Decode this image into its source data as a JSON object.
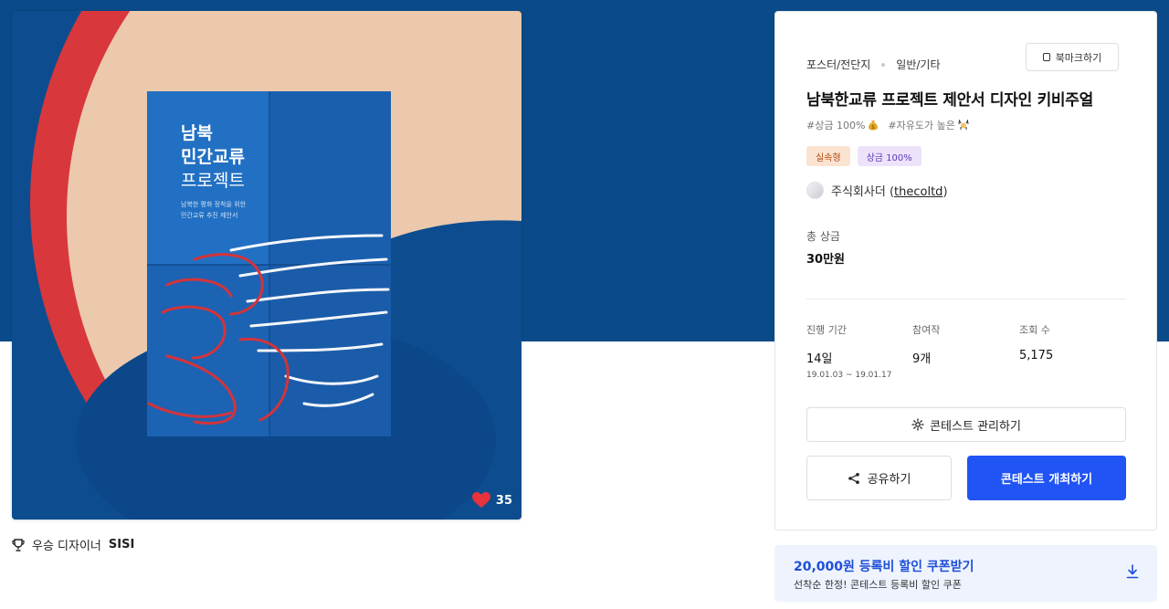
{
  "colors": {
    "hero_background": "#0a4a88",
    "primary_button": "#2154f4",
    "coupon_background": "#eef3fe",
    "coupon_title": "#1d4fd8",
    "heart": "#e8323c"
  },
  "artwork": {
    "poster_title_line1": "남북",
    "poster_title_line2": "민간교류",
    "poster_title_line3": "프로젝트",
    "poster_subtitle_line1": "남북한 평화 정착을 위한",
    "poster_subtitle_line2": "민간교류 추진 제안서",
    "likes": "35",
    "like_icon": "heart-icon"
  },
  "winner": {
    "icon": "trophy-icon",
    "label": "우승 디자이너",
    "name": "SISI"
  },
  "contest": {
    "category": "포스터/전단지",
    "subcategory": "일반/기타",
    "bookmark_label": "북마크하기",
    "title": "남북한교류 프로젝트 제안서 디자인 키비주얼",
    "tags": [
      "#상금 100%",
      "#자유도가 높은"
    ],
    "badges": [
      "실속형",
      "상금 100%"
    ],
    "host_name": "주식회사더",
    "host_handle": "thecoltd",
    "prize_label": "총 상금",
    "prize_amount": "30만원",
    "stats": {
      "period_label": "진행 기간",
      "period_value": "14일",
      "period_dates": "19.01.03 ~ 19.01.17",
      "entries_label": "참여작",
      "entries_value": "9개",
      "views_label": "조회 수",
      "views_value": "5,175"
    },
    "manage_button": "콘테스트 관리하기",
    "share_button": "공유하기",
    "host_button": "콘테스트 개최하기"
  },
  "coupon": {
    "title": "20,000원 등록비 할인 쿠폰받기",
    "subtitle": "선착순 한정! 콘테스트 등록비 할인 쿠폰",
    "icon": "download-icon"
  }
}
